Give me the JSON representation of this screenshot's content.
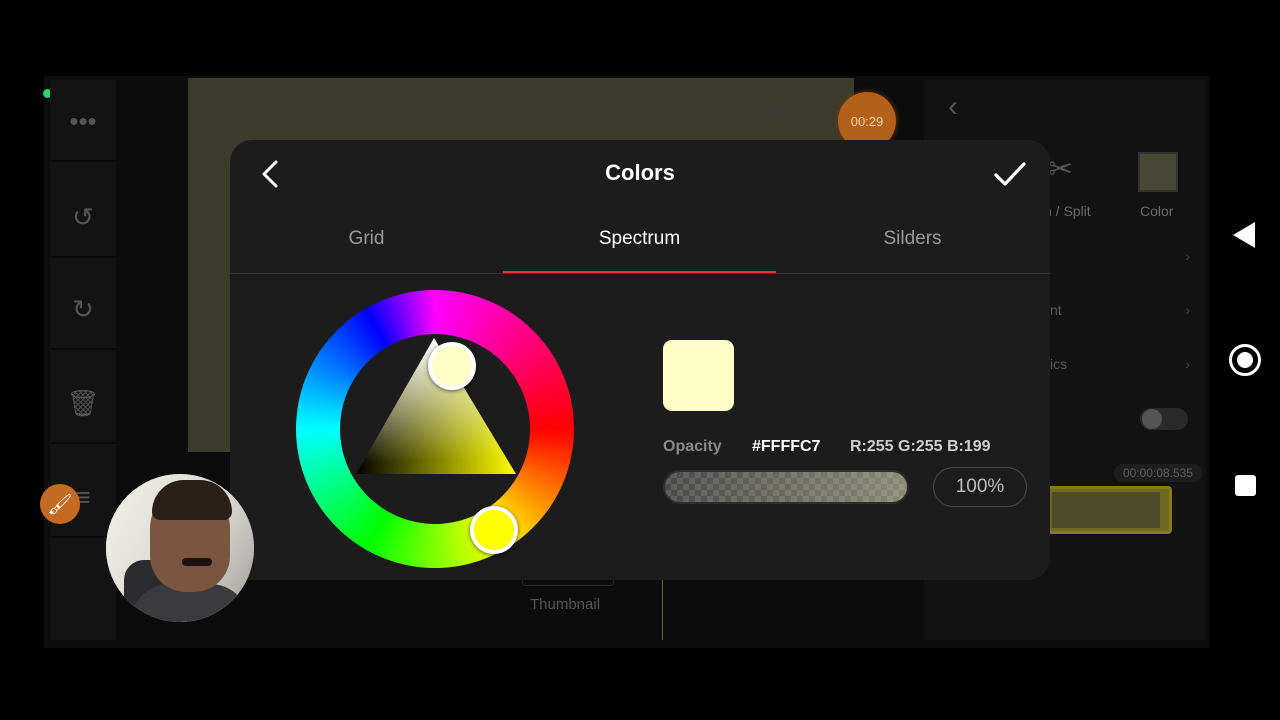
{
  "dialog": {
    "title": "Colors",
    "tabs": [
      {
        "label": "Grid",
        "active": false
      },
      {
        "label": "Spectrum",
        "active": true
      },
      {
        "label": "Silders",
        "active": false
      }
    ],
    "opacity_label": "Opacity",
    "hex": "#FFFFC7",
    "rgb": "R:255 G:255 B:199",
    "opacity_value": "100%",
    "opacity_fraction": 1.0,
    "selected_color": "#FFFFC7",
    "hue_color": "#FFFF00",
    "accent_color": "#E8343A"
  },
  "background": {
    "timer": "00:29",
    "right_panel": {
      "split_label": "n / Split",
      "color_label": "Color",
      "rows": [
        "",
        "nt",
        "ics"
      ]
    },
    "timecode": "00:00:08.535",
    "thumbnail_label": "Thumbnail"
  },
  "icons": {
    "more": "more-horizontal-icon",
    "undo": "undo-icon",
    "redo": "redo-icon",
    "delete": "trash-icon",
    "brush": "brush-icon",
    "scissors": "scissors-icon",
    "back": "chevron-left-icon",
    "confirm": "checkmark-icon"
  }
}
